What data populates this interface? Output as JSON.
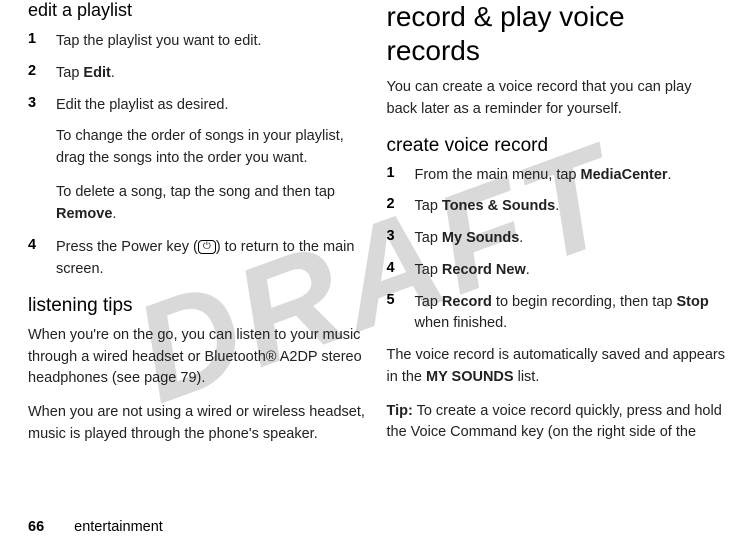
{
  "watermark": "DRAFT",
  "leftColumn": {
    "editPlaylistTitle": "edit a playlist",
    "step1": {
      "num": "1",
      "text": "Tap the playlist you want to edit."
    },
    "step2": {
      "num": "2",
      "prefix": "Tap ",
      "bold": "Edit",
      "suffix": "."
    },
    "step3": {
      "num": "3",
      "text": "Edit the playlist as desired."
    },
    "step3a": "To change the order of songs in your playlist, drag the songs into the order you want.",
    "step3b_prefix": "To delete a song, tap the song and then tap ",
    "step3b_bold": "Remove",
    "step3b_suffix": ".",
    "step4": {
      "num": "4",
      "prefix": "Press the Power key (",
      "suffix": ") to return to the main screen."
    },
    "listeningTipsTitle": "listening tips",
    "listeningP1": "When you're on the go, you can listen to your music through a wired headset or Bluetooth® A2DP stereo headphones (see page 79).",
    "listeningP2": "When you are not using a wired or wireless headset, music is played through the phone's speaker."
  },
  "rightColumn": {
    "recordTitle": "record & play voice records",
    "recordIntro": "You can create a voice record that you can play back later as a reminder for yourself.",
    "createTitle": "create voice record",
    "r1": {
      "num": "1",
      "prefix": "From the main menu, tap ",
      "bold": "MediaCenter",
      "suffix": "."
    },
    "r2": {
      "num": "2",
      "prefix": "Tap ",
      "bold": "Tones & Sounds",
      "suffix": "."
    },
    "r3": {
      "num": "3",
      "prefix": "Tap ",
      "bold": "My Sounds",
      "suffix": "."
    },
    "r4": {
      "num": "4",
      "prefix": "Tap ",
      "bold": "Record New",
      "suffix": "."
    },
    "r5": {
      "num": "5",
      "prefix": "Tap ",
      "bold1": "Record",
      "mid": " to begin recording, then tap ",
      "bold2": "Stop",
      "suffix": " when finished."
    },
    "recordSaved_prefix": "The voice record is automatically saved and appears in the ",
    "recordSaved_bold": "MY SOUNDS",
    "recordSaved_suffix": " list.",
    "tip_bold": "Tip:",
    "tip_text": " To create a voice record quickly, press and hold the Voice Command key (on the right side of the"
  },
  "footer": {
    "pageNum": "66",
    "section": "entertainment"
  }
}
